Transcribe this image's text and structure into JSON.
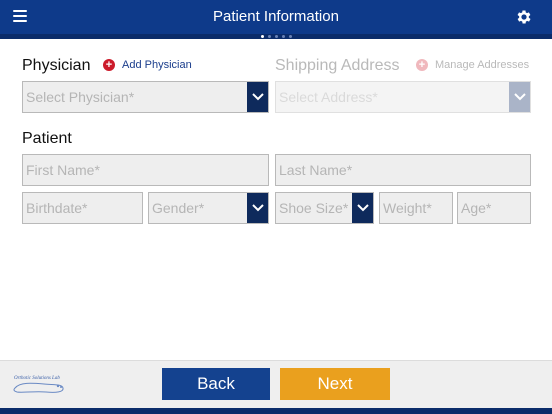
{
  "header": {
    "title": "Patient Information",
    "pager_total": 5,
    "pager_active": 1,
    "menu_icon": "menu-icon",
    "settings_icon": "gear-icon"
  },
  "physician": {
    "label": "Physician",
    "add_label": "Add Physician",
    "select_placeholder": "Select Physician*"
  },
  "shipping": {
    "label": "Shipping Address",
    "manage_label": "Manage Addresses",
    "select_placeholder": "Select Address*"
  },
  "patient": {
    "label": "Patient",
    "first_name": "First Name*",
    "last_name": "Last Name*",
    "birthdate": "Birthdate*",
    "gender": "Gender*",
    "shoe_size": "Shoe Size*",
    "weight": "Weight*",
    "age": "Age*"
  },
  "footer": {
    "back_label": "Back",
    "next_label": "Next",
    "logo_text": "Orthotic Solutions Lab"
  },
  "colors": {
    "header": "#0e3a8a",
    "caret": "#0e2a5c",
    "back": "#14428f",
    "next": "#eaa01e",
    "add_icon": "#cc1b2b"
  }
}
